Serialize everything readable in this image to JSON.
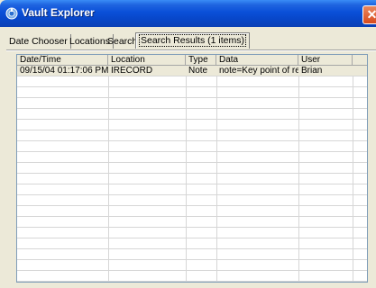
{
  "window": {
    "title": "Vault Explorer",
    "close_glyph": "✕",
    "app_icon": "vault-icon"
  },
  "tabs": [
    {
      "label": "Date Chooser"
    },
    {
      "label": "Locations"
    },
    {
      "label": "Search"
    },
    {
      "label": "Search Results (1 items)",
      "active": true
    }
  ],
  "table": {
    "columns": [
      "Date/Time",
      "Location",
      "Type",
      "Data",
      "User"
    ],
    "rows": [
      {
        "datetime": "09/15/04 01:17:06 PM",
        "location": "IRECORD",
        "type": "Note",
        "data": "note=Key point of re...",
        "user": "Brian"
      }
    ]
  }
}
